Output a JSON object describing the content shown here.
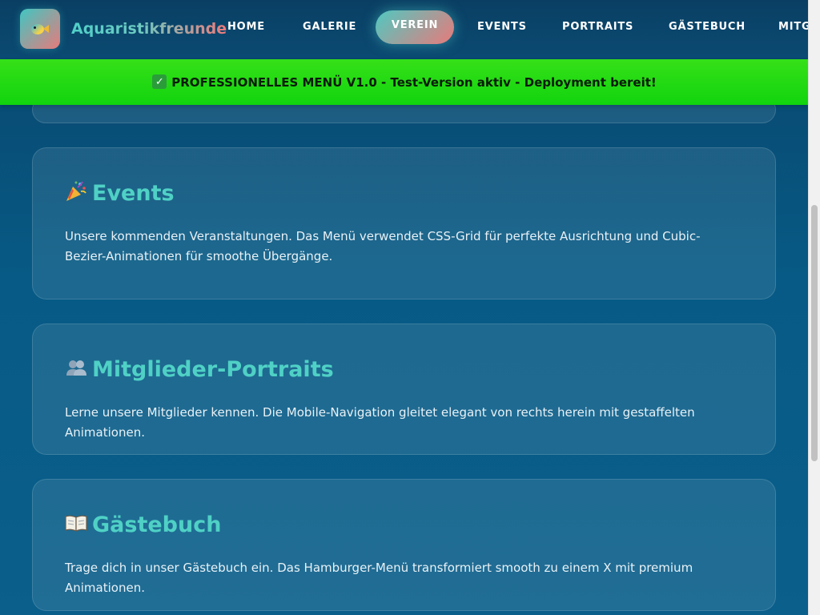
{
  "header": {
    "brand": "Aquaristikfreunde",
    "nav": [
      {
        "label": "HOME"
      },
      {
        "label": "GALERIE"
      },
      {
        "label": "VEREIN",
        "active": true
      },
      {
        "label": "EVENTS"
      },
      {
        "label": "PORTRAITS"
      },
      {
        "label": "GÄSTEBUCH"
      },
      {
        "label": "MITGLIEDER"
      }
    ],
    "logo_icon": "fish-icon"
  },
  "banner": {
    "icon": "check-icon",
    "text": "PROFESSIONELLES MENÜ V1.0 - Test-Version aktiv - Deployment bereit!"
  },
  "sections": [
    {
      "icon": "party-popper-icon",
      "title": "Events",
      "text": "Unsere kommenden Veranstaltungen. Das Menü verwendet CSS-Grid für perfekte Ausrichtung und Cubic-Bezier-Animationen für smoothe Übergänge."
    },
    {
      "icon": "people-icon",
      "title": "Mitglieder-Portraits",
      "text": "Lerne unsere Mitglieder kennen. Die Mobile-Navigation gleitet elegant von rechts herein mit gestaffelten Animationen."
    },
    {
      "icon": "open-book-icon",
      "title": "Gästebuch",
      "text": "Trage dich in unser Gästebuch ein. Das Hamburger-Menü transformiert smooth zu einem X mit premium Animationen."
    }
  ],
  "colors": {
    "accent_teal": "#4fd1c5",
    "accent_coral": "#e87a7a",
    "banner_green": "#11d40e",
    "background": "#075a85"
  }
}
